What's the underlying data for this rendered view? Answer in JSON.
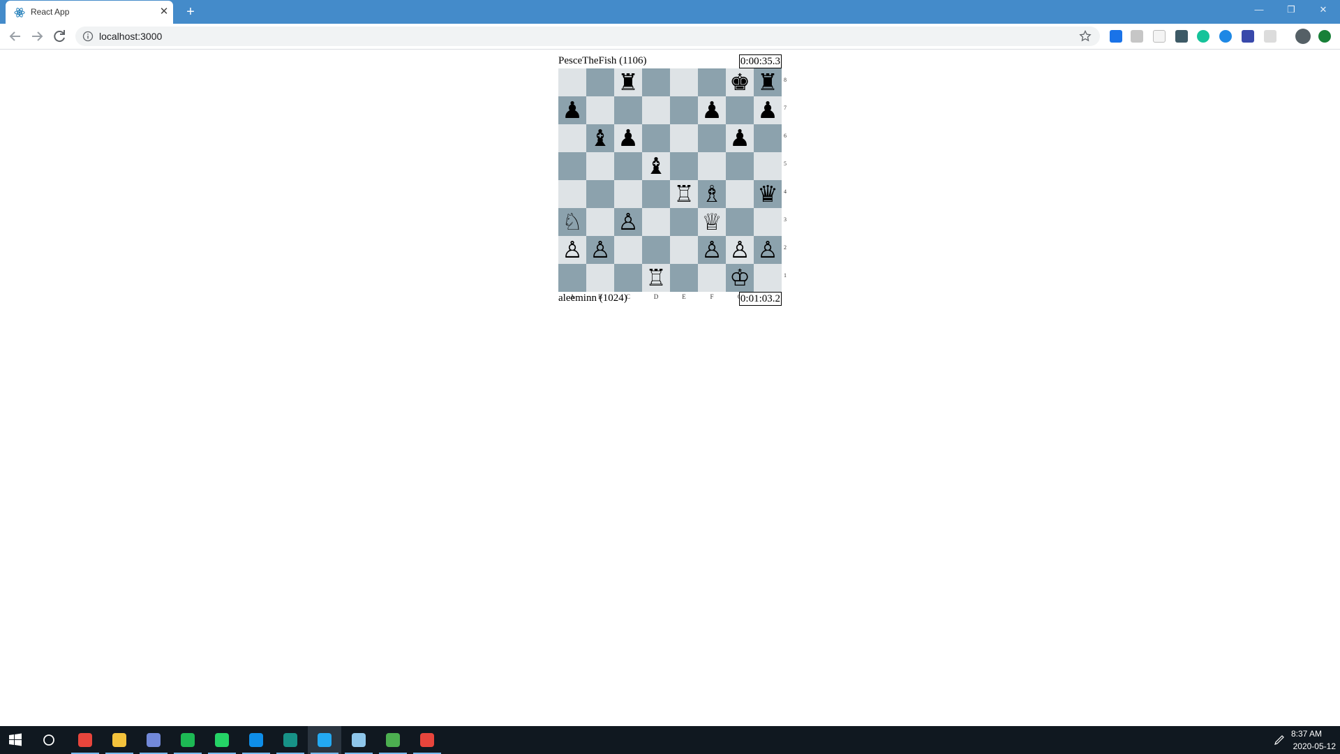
{
  "browser": {
    "tab_title": "React App",
    "url": "localhost:3000",
    "accent": "#448bca"
  },
  "game": {
    "top_player": {
      "name": "PesceTheFish (1106)",
      "clock": "0:00:35.3",
      "color": "black"
    },
    "bottom_player": {
      "name": "aleeminn (1024)",
      "clock": "0:01:03.2",
      "color": "white"
    },
    "board_colors": {
      "light": "#dee3e6",
      "dark": "#8ca2ad"
    },
    "ranks": [
      "8",
      "7",
      "6",
      "5",
      "4",
      "3",
      "2",
      "1"
    ],
    "files": [
      "A",
      "B",
      "C",
      "D",
      "E",
      "F",
      "G",
      "H"
    ],
    "pieces": [
      {
        "square": "c8",
        "glyph": "♜",
        "name": "black-rook"
      },
      {
        "square": "g8",
        "glyph": "♚",
        "name": "black-king"
      },
      {
        "square": "h8",
        "glyph": "♜",
        "name": "black-rook"
      },
      {
        "square": "a7",
        "glyph": "♟",
        "name": "black-pawn"
      },
      {
        "square": "f7",
        "glyph": "♟",
        "name": "black-pawn"
      },
      {
        "square": "h7",
        "glyph": "♟",
        "name": "black-pawn"
      },
      {
        "square": "b6",
        "glyph": "♝",
        "name": "black-bishop"
      },
      {
        "square": "c6",
        "glyph": "♟",
        "name": "black-pawn"
      },
      {
        "square": "g6",
        "glyph": "♟",
        "name": "black-pawn"
      },
      {
        "square": "d5",
        "glyph": "♝",
        "name": "black-bishop"
      },
      {
        "square": "e4",
        "glyph": "♖",
        "name": "white-rook"
      },
      {
        "square": "f4",
        "glyph": "♗",
        "name": "white-bishop"
      },
      {
        "square": "h4",
        "glyph": "♛",
        "name": "black-queen"
      },
      {
        "square": "a3",
        "glyph": "♘",
        "name": "white-knight"
      },
      {
        "square": "c3",
        "glyph": "♙",
        "name": "white-pawn"
      },
      {
        "square": "f3",
        "glyph": "♕",
        "name": "white-queen"
      },
      {
        "square": "a2",
        "glyph": "♙",
        "name": "white-pawn"
      },
      {
        "square": "b2",
        "glyph": "♙",
        "name": "white-pawn"
      },
      {
        "square": "f2",
        "glyph": "♙",
        "name": "white-pawn"
      },
      {
        "square": "g2",
        "glyph": "♙",
        "name": "white-pawn"
      },
      {
        "square": "h2",
        "glyph": "♙",
        "name": "white-pawn"
      },
      {
        "square": "d1",
        "glyph": "♖",
        "name": "white-rook"
      },
      {
        "square": "g1",
        "glyph": "♔",
        "name": "white-king"
      }
    ]
  },
  "taskbar": {
    "apps": [
      {
        "name": "chrome",
        "color": "#e8453c"
      },
      {
        "name": "file-explorer",
        "color": "#f3c23c"
      },
      {
        "name": "discord",
        "color": "#7289da"
      },
      {
        "name": "spotify",
        "color": "#1db954"
      },
      {
        "name": "whatsapp",
        "color": "#25d366"
      },
      {
        "name": "teamviewer",
        "color": "#0e8ee9"
      },
      {
        "name": "git-kraken",
        "color": "#179287"
      },
      {
        "name": "vscode",
        "color": "#23a9f2"
      },
      {
        "name": "notepad",
        "color": "#8ec6ea"
      },
      {
        "name": "excel-like",
        "color": "#4caf50"
      },
      {
        "name": "chrome-2",
        "color": "#e8453c"
      }
    ],
    "time": "8:37 AM",
    "date": "2020-05-12"
  }
}
